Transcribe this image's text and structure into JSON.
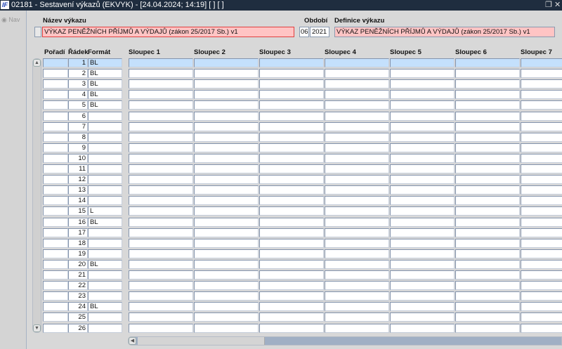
{
  "window": {
    "title": "02181 - Sestavení výkazů (EKVYK) - [24.04.2024; 14:19] [ ] [ ]",
    "logo": "IF",
    "restore_icon": "restore-icon",
    "close_icon": "close-icon"
  },
  "nav": {
    "label": "Nav"
  },
  "header": {
    "name_label": "Název výkazu",
    "name_value": "VÝKAZ PENĚŽNÍCH PŘÍJMŮ A VÝDAJŮ (zákon 25/2017 Sb.) v1",
    "period_label": "Období",
    "period_month": "06",
    "period_year": "2021",
    "definition_label": "Definice výkazu",
    "definition_value": "VÝKAZ PENĚŽNÍCH PŘÍJMŮ A VÝDAJŮ (zákon 25/2017 Sb.) v1"
  },
  "grid": {
    "columns": [
      "Pořadí",
      "Řádek",
      "Formát",
      "Sloupec 1",
      "Sloupec 2",
      "Sloupec 3",
      "Sloupec 4",
      "Sloupec 5",
      "Sloupec 6",
      "Sloupec 7"
    ],
    "rows": [
      {
        "radek": "1",
        "format": "BL"
      },
      {
        "radek": "2",
        "format": "BL"
      },
      {
        "radek": "3",
        "format": "BL"
      },
      {
        "radek": "4",
        "format": "BL"
      },
      {
        "radek": "5",
        "format": "BL"
      },
      {
        "radek": "6",
        "format": ""
      },
      {
        "radek": "7",
        "format": ""
      },
      {
        "radek": "8",
        "format": ""
      },
      {
        "radek": "9",
        "format": ""
      },
      {
        "radek": "10",
        "format": ""
      },
      {
        "radek": "11",
        "format": ""
      },
      {
        "radek": "12",
        "format": ""
      },
      {
        "radek": "13",
        "format": ""
      },
      {
        "radek": "14",
        "format": ""
      },
      {
        "radek": "15",
        "format": "L"
      },
      {
        "radek": "16",
        "format": "BL"
      },
      {
        "radek": "17",
        "format": ""
      },
      {
        "radek": "18",
        "format": ""
      },
      {
        "radek": "19",
        "format": ""
      },
      {
        "radek": "20",
        "format": "BL"
      },
      {
        "radek": "21",
        "format": ""
      },
      {
        "radek": "22",
        "format": ""
      },
      {
        "radek": "23",
        "format": ""
      },
      {
        "radek": "24",
        "format": "BL"
      },
      {
        "radek": "25",
        "format": ""
      },
      {
        "radek": "26",
        "format": ""
      }
    ],
    "selected_row": 0
  },
  "colors": {
    "titlebar": "#1f2d3f",
    "selected_row": "#c4e0fc",
    "required_field": "#ffc4c4"
  }
}
